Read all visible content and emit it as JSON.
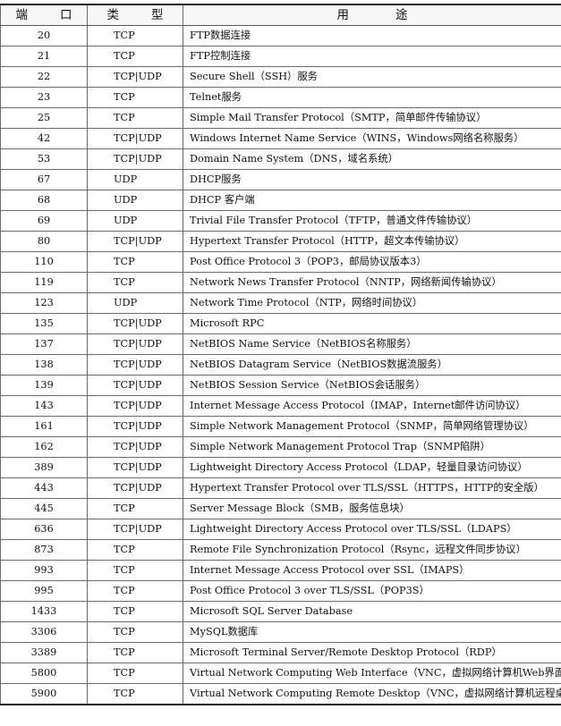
{
  "table": {
    "headers": {
      "port": [
        "端",
        "口"
      ],
      "type": [
        "类",
        "型"
      ],
      "usage": [
        "用",
        "途"
      ]
    },
    "rows": [
      {
        "port": "20",
        "type": "TCP",
        "usage": "FTP数据连接"
      },
      {
        "port": "21",
        "type": "TCP",
        "usage": "FTP控制连接"
      },
      {
        "port": "22",
        "type": "TCP|UDP",
        "usage": "Secure Shell（SSH）服务"
      },
      {
        "port": "23",
        "type": "TCP",
        "usage": "Telnet服务"
      },
      {
        "port": "25",
        "type": "TCP",
        "usage": "Simple Mail Transfer Protocol（SMTP，简单邮件传输协议）"
      },
      {
        "port": "42",
        "type": "TCP|UDP",
        "usage": "Windows Internet Name Service（WINS，Windows网络名称服务）"
      },
      {
        "port": "53",
        "type": "TCP|UDP",
        "usage": "Domain Name System（DNS，域名系统）"
      },
      {
        "port": "67",
        "type": "UDP",
        "usage": "DHCP服务"
      },
      {
        "port": "68",
        "type": "UDP",
        "usage": "DHCP 客户端"
      },
      {
        "port": "69",
        "type": "UDP",
        "usage": "Trivial File Transfer Protocol（TFTP，普通文件传输协议）"
      },
      {
        "port": "80",
        "type": "TCP|UDP",
        "usage": "Hypertext Transfer Protocol（HTTP，超文本传输协议）"
      },
      {
        "port": "110",
        "type": "TCP",
        "usage": "Post Office Protocol 3（POP3，邮局协议版本3）"
      },
      {
        "port": "119",
        "type": "TCP",
        "usage": "Network News Transfer Protocol（NNTP，网络新闻传输协议）"
      },
      {
        "port": "123",
        "type": "UDP",
        "usage": "Network Time Protocol（NTP，网络时间协议）"
      },
      {
        "port": "135",
        "type": "TCP|UDP",
        "usage": "Microsoft RPC"
      },
      {
        "port": "137",
        "type": "TCP|UDP",
        "usage": "NetBIOS Name Service（NetBIOS名称服务）"
      },
      {
        "port": "138",
        "type": "TCP|UDP",
        "usage": "NetBIOS Datagram Service（NetBIOS数据流服务）"
      },
      {
        "port": "139",
        "type": "TCP|UDP",
        "usage": "NetBIOS Session Service（NetBIOS会话服务）"
      },
      {
        "port": "143",
        "type": "TCP|UDP",
        "usage": "Internet Message Access Protocol（IMAP，Internet邮件访问协议）"
      },
      {
        "port": "161",
        "type": "TCP|UDP",
        "usage": "Simple Network Management Protocol（SNMP，简单网络管理协议）"
      },
      {
        "port": "162",
        "type": "TCP|UDP",
        "usage": "Simple Network Management Protocol Trap（SNMP陷阱）"
      },
      {
        "port": "389",
        "type": "TCP|UDP",
        "usage": "Lightweight Directory Access Protocol（LDAP，轻量目录访问协议）"
      },
      {
        "port": "443",
        "type": "TCP|UDP",
        "usage": "Hypertext Transfer Protocol over TLS/SSL（HTTPS，HTTP的安全版）"
      },
      {
        "port": "445",
        "type": "TCP",
        "usage": "Server Message Block（SMB，服务信息块）"
      },
      {
        "port": "636",
        "type": "TCP|UDP",
        "usage": "Lightweight Directory Access Protocol over TLS/SSL（LDAPS）"
      },
      {
        "port": "873",
        "type": "TCP",
        "usage": "Remote File Synchronization Protocol（Rsync，远程文件同步协议）"
      },
      {
        "port": "993",
        "type": "TCP",
        "usage": "Internet Message Access Protocol over SSL（IMAPS）"
      },
      {
        "port": "995",
        "type": "TCP",
        "usage": "Post Office Protocol 3 over TLS/SSL（POP3S）"
      },
      {
        "port": "1433",
        "type": "TCP",
        "usage": "Microsoft SQL Server Database"
      },
      {
        "port": "3306",
        "type": "TCP",
        "usage": "MySQL数据库"
      },
      {
        "port": "3389",
        "type": "TCP",
        "usage": "Microsoft Terminal Server/Remote Desktop Protocol（RDP）"
      },
      {
        "port": "5800",
        "type": "TCP",
        "usage": "Virtual Network Computing Web Interface（VNC，虚拟网络计算机Web界面）"
      },
      {
        "port": "5900",
        "type": "TCP",
        "usage": "Virtual Network Computing Remote Desktop（VNC，虚拟网络计算机远程桌面）"
      }
    ]
  }
}
